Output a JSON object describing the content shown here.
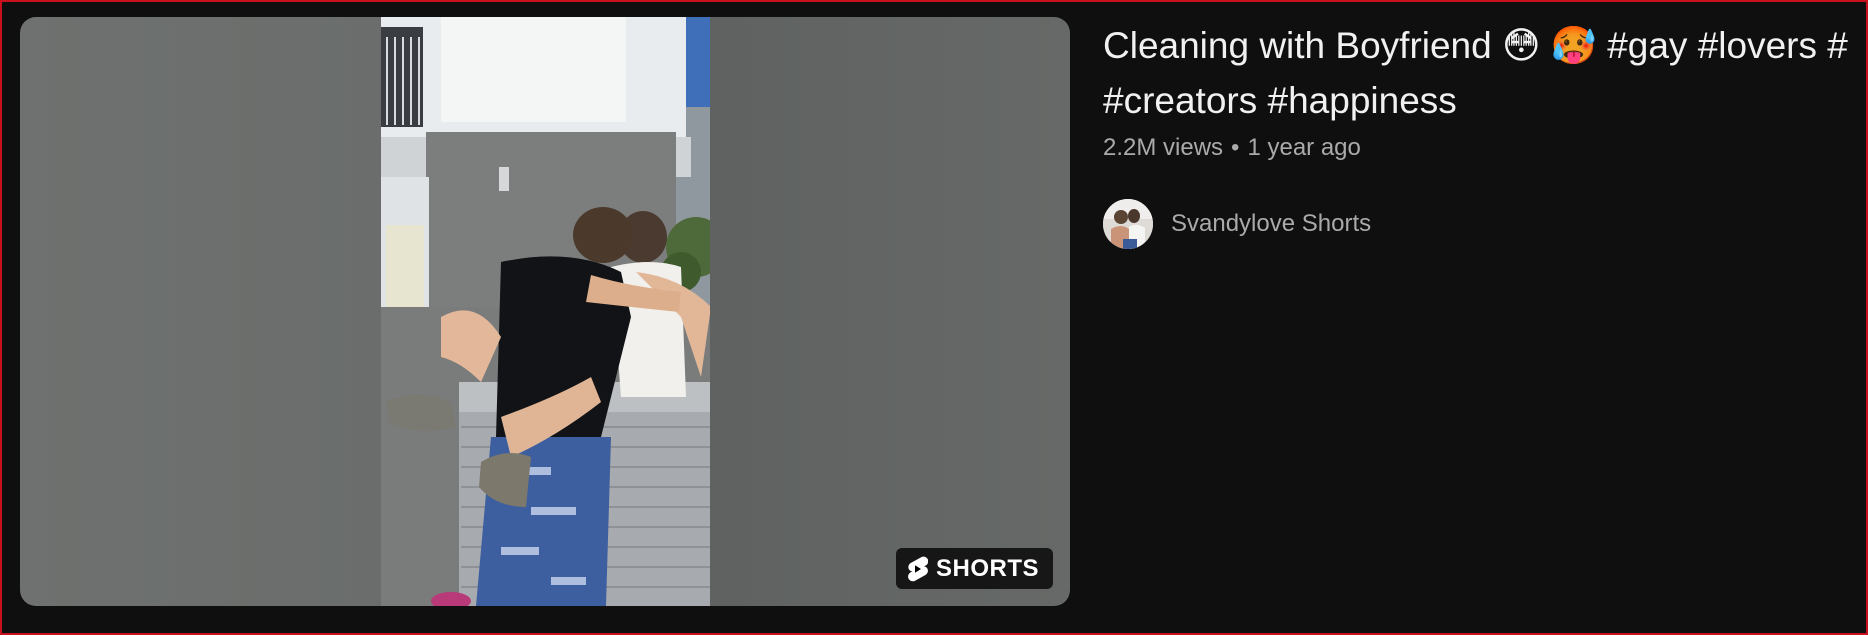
{
  "video": {
    "title_line1": "Cleaning with Boyfriend 😳 🥵 #gay #lovers #",
    "title_line2": "#creators #happiness",
    "views": "2.2M views",
    "separator": "•",
    "age": "1 year ago"
  },
  "thumbnail": {
    "badge_label": "SHORTS",
    "badge_icon": "shorts-logo-icon"
  },
  "channel": {
    "name": "Svandylove Shorts"
  },
  "colors": {
    "background": "#0f0f0f",
    "title": "#f1f1f1",
    "meta": "#aaaaaa",
    "frame_border": "#c8101e"
  }
}
